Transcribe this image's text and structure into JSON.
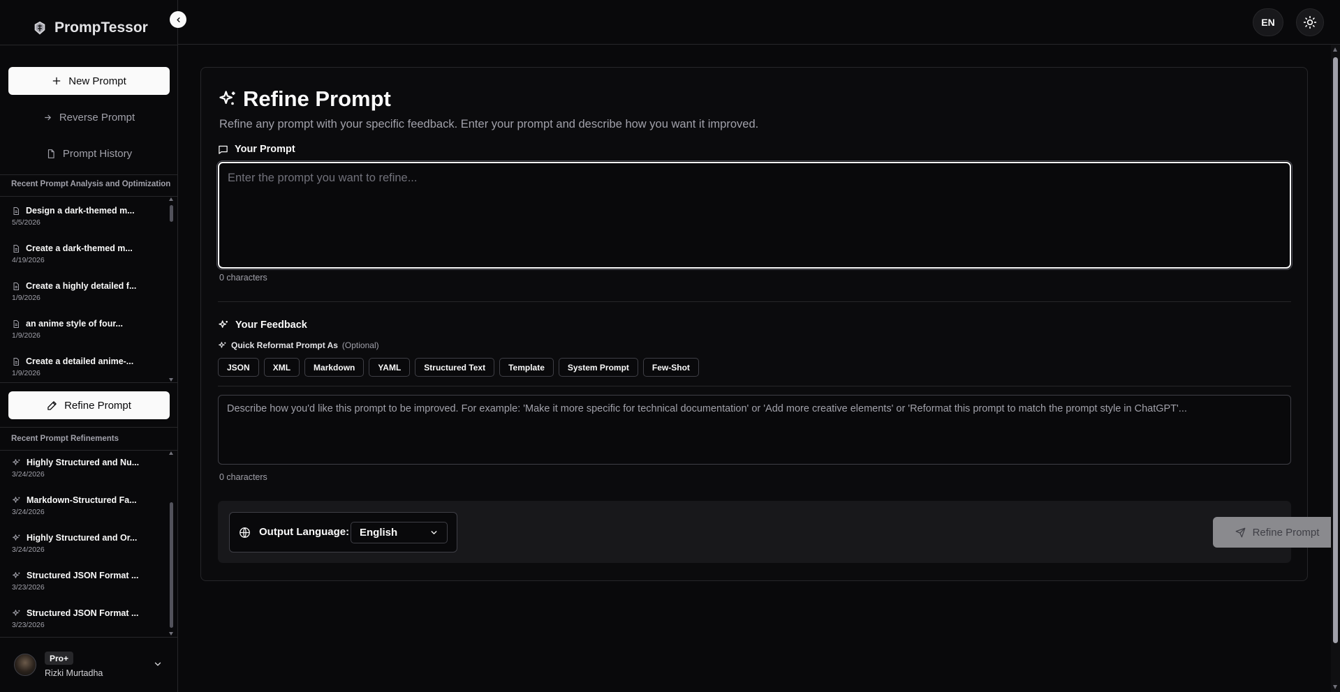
{
  "app": {
    "brand": "PrompTessor"
  },
  "sidebar": {
    "new_prompt": "New Prompt",
    "reverse_prompt": "Reverse Prompt",
    "prompt_history": "Prompt History",
    "analysis_section": "Recent Prompt Analysis and Optimization",
    "analysis_items": [
      {
        "title": "Design a dark-themed m...",
        "date": "5/5/2026"
      },
      {
        "title": "Create a dark-themed m...",
        "date": "4/19/2026"
      },
      {
        "title": "Create a highly detailed f...",
        "date": "1/9/2026"
      },
      {
        "title": "an anime style of four...",
        "date": "1/9/2026"
      },
      {
        "title": "Create a detailed anime-...",
        "date": "1/9/2026"
      }
    ],
    "refine_button": "Refine Prompt",
    "refinements_section": "Recent Prompt Refinements",
    "refinement_items": [
      {
        "title": "Highly Structured and Nu...",
        "date": "3/24/2026"
      },
      {
        "title": "Markdown-Structured Fa...",
        "date": "3/24/2026"
      },
      {
        "title": "Highly Structured and Or...",
        "date": "3/24/2026"
      },
      {
        "title": "Structured JSON Format ...",
        "date": "3/23/2026"
      },
      {
        "title": "Structured JSON Format ...",
        "date": "3/23/2026"
      }
    ],
    "user": {
      "plan": "Pro+",
      "name": "Rizki Murtadha"
    }
  },
  "topbar": {
    "language": "EN"
  },
  "main": {
    "title": "Refine Prompt",
    "subtitle": "Refine any prompt with your specific feedback. Enter your prompt and describe how you want it improved.",
    "prompt_label": "Your Prompt",
    "prompt_placeholder": "Enter the prompt you want to refine...",
    "prompt_count": "0 characters",
    "feedback_label": "Your Feedback",
    "quick_label": "Quick Reformat Prompt As",
    "quick_optional": "(Optional)",
    "formats": [
      "JSON",
      "XML",
      "Markdown",
      "YAML",
      "Structured Text",
      "Template",
      "System Prompt",
      "Few-Shot"
    ],
    "feedback_placeholder": "Describe how you'd like this prompt to be improved. For example: 'Make it more specific for technical documentation' or 'Add more creative elements' or 'Reformat this prompt to match the prompt style in ChatGPT'...",
    "feedback_count": "0 characters",
    "output_language_label": "Output Language:",
    "output_language_value": "English",
    "submit": "Refine Prompt"
  },
  "icons": {
    "logo": "brain-logo-icon",
    "collapse": "chevron-left-icon",
    "new_prompt": "plus-icon",
    "reverse": "arrow-right-icon",
    "history": "file-icon",
    "analysis_item": "file-text-icon",
    "refine": "pencil-icon",
    "refinement_item": "sparkles-icon",
    "theme": "sun-icon",
    "prompt_label": "message-square-icon",
    "globe": "globe-icon",
    "send": "send-icon"
  },
  "colors": {
    "background": "#09090b",
    "border": "#27272a",
    "accent": "#fafafa",
    "muted": "#a1a1aa",
    "submit_disabled": "#8a8a8e"
  }
}
